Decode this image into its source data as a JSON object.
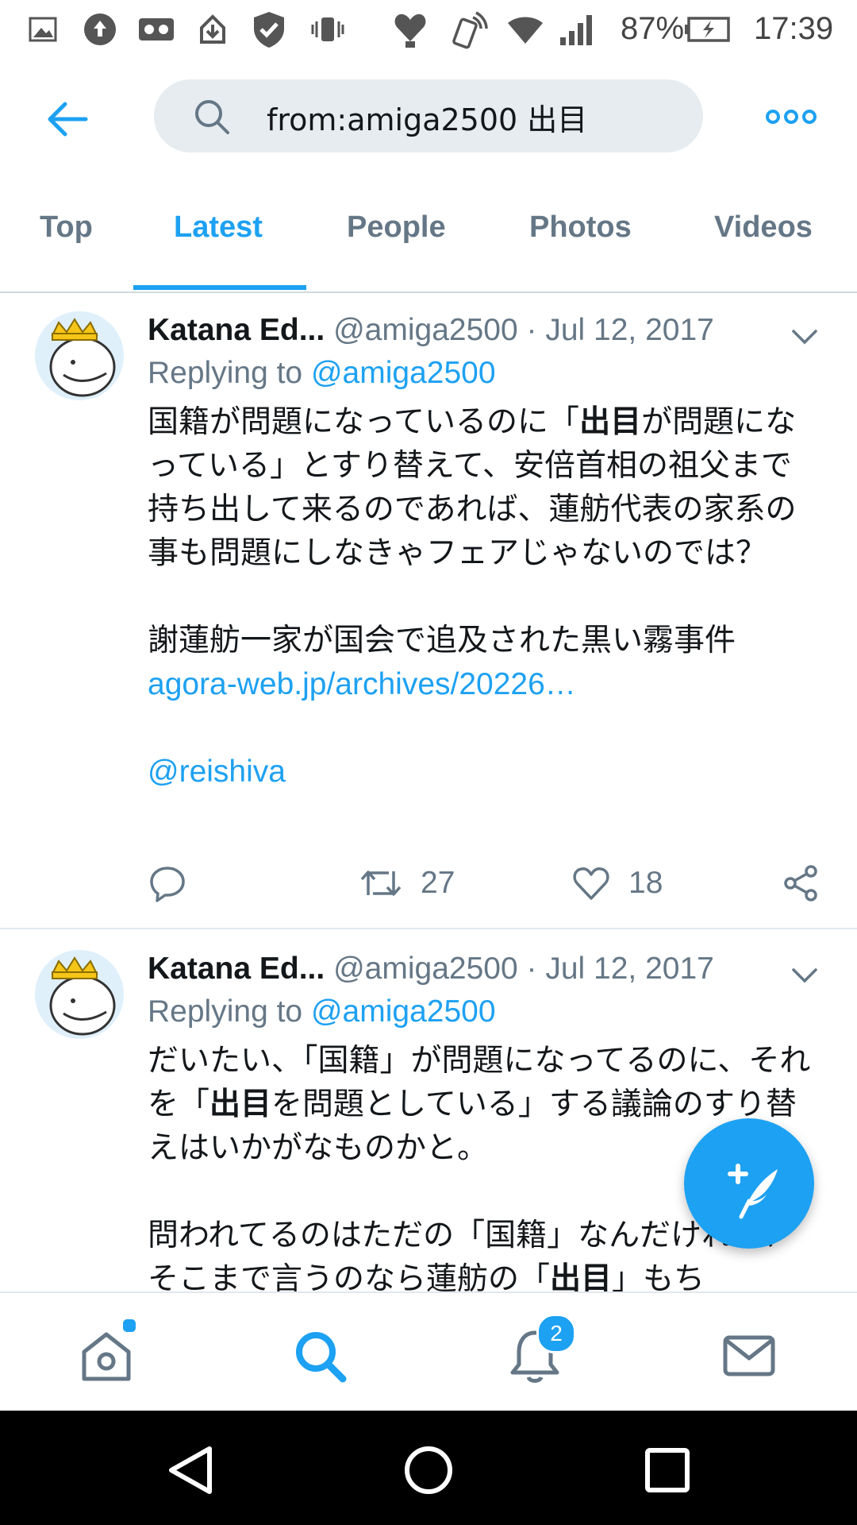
{
  "status_bar": {
    "battery": "87%",
    "time": "17:39",
    "icons": [
      "image-icon",
      "upload-icon",
      "voicemail-icon",
      "download-icon",
      "shield-icon",
      "vibrate-icon",
      "heart-monitor-icon",
      "nfc-icon",
      "wifi-icon",
      "signal-icon",
      "battery-charging-icon"
    ]
  },
  "header": {
    "search_query": "from:amiga2500 出目",
    "back_icon": "arrow-left-icon",
    "more_icon": "more-dots-icon"
  },
  "tabs": [
    {
      "label": "Top",
      "active": false
    },
    {
      "label": "Latest",
      "active": true
    },
    {
      "label": "People",
      "active": false
    },
    {
      "label": "Photos",
      "active": false
    },
    {
      "label": "Videos",
      "active": false
    }
  ],
  "tweets": [
    {
      "name": "Katana Ed...",
      "handle": "@amiga2500",
      "dot": "·",
      "date": "Jul 12, 2017",
      "replying_prefix": "Replying to",
      "replying_to": "@amiga2500",
      "body": {
        "p1_a": "国籍が問題になっているのに「",
        "p1_bold": "出目",
        "p1_b": "が問題になっている」とすり替えて、安倍首相の祖父まで持ち出して来るのであれば、蓮舫代表の家系の事も問題にしなきゃフェアじゃないのでは？",
        "p2": "謝蓮舫一家が国会で追及された黒い霧事件",
        "link": "agora-web.jp/archives/20226…",
        "mention": "@reishiva"
      },
      "actions": {
        "reply_count": "",
        "retweet_count": "27",
        "like_count": "18"
      }
    },
    {
      "name": "Katana Ed...",
      "handle": "@amiga2500",
      "dot": "·",
      "date": "Jul 12, 2017",
      "replying_prefix": "Replying to",
      "replying_to": "@amiga2500",
      "body": {
        "p1_a": "だいたい、「国籍」が問題になってるのに、それを「",
        "p1_bold": "出目",
        "p1_b": "を問題としている」する議論のすり替えはいかがなものかと。",
        "p2_a": "問われてるのはただの「国籍」なんだけれど、そこまで言うのなら蓮舫の「",
        "p2_bold": "出目",
        "p2_b": "」もち"
      }
    }
  ],
  "bottom_nav": {
    "items": [
      "home-icon",
      "search-icon",
      "notifications-icon",
      "messages-icon"
    ],
    "active": "search-icon",
    "notifications_badge": "2"
  },
  "compose_button": "compose-tweet-icon",
  "colors": {
    "accent": "#1da1f2",
    "secondary_text": "#657786",
    "search_bg": "#e6ecf0"
  }
}
